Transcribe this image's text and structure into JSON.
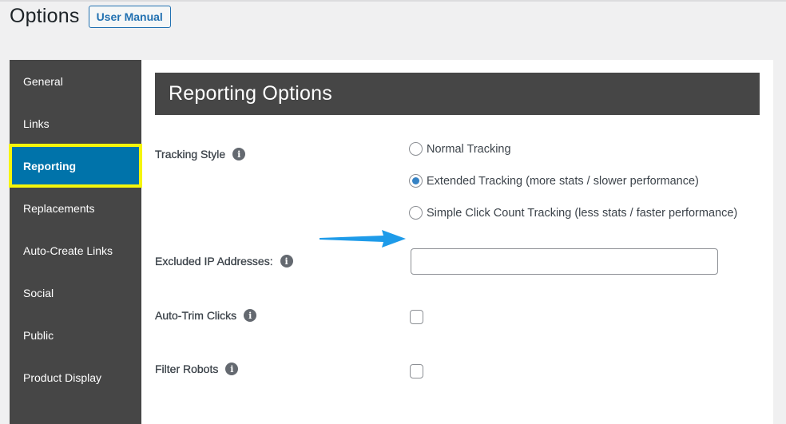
{
  "header": {
    "title": "Options",
    "user_manual_label": "User Manual"
  },
  "sidebar": {
    "items": [
      {
        "label": "General",
        "active": false
      },
      {
        "label": "Links",
        "active": false
      },
      {
        "label": "Reporting",
        "active": true
      },
      {
        "label": "Replacements",
        "active": false
      },
      {
        "label": "Auto-Create Links",
        "active": false
      },
      {
        "label": "Social",
        "active": false
      },
      {
        "label": "Public",
        "active": false
      },
      {
        "label": "Product Display",
        "active": false
      }
    ]
  },
  "section": {
    "title": "Reporting Options"
  },
  "tracking_style": {
    "label": "Tracking Style",
    "info_icon": "i",
    "options": [
      {
        "label": "Normal Tracking",
        "checked": false
      },
      {
        "label": "Extended Tracking (more stats / slower performance)",
        "checked": true
      },
      {
        "label": "Simple Click Count Tracking (less stats / faster performance)",
        "checked": false
      }
    ]
  },
  "excluded_ips": {
    "label": "Excluded IP Addresses:",
    "info_icon": "i",
    "value": ""
  },
  "auto_trim": {
    "label": "Auto-Trim Clicks",
    "info_icon": "i",
    "checked": false
  },
  "filter_robots": {
    "label": "Filter Robots",
    "info_icon": "i",
    "checked": false
  },
  "annotation": {
    "arrow_color": "#1e9be9",
    "highlight_color": "#f5f50a"
  },
  "colors": {
    "accent": "#0073aa",
    "sidebar_bg": "#464646",
    "radio_checked": "#3582c4"
  }
}
